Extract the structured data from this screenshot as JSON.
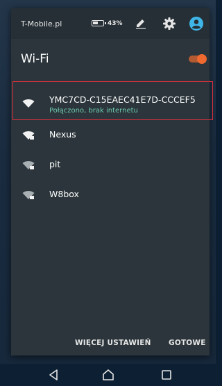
{
  "status_bar": {
    "carrier": "T-Mobile.pl",
    "battery_percent": "43%",
    "icons": [
      "battery-icon",
      "edit-pen-icon",
      "settings-gear-icon",
      "user-account-icon"
    ]
  },
  "wifi": {
    "title": "Wi-Fi",
    "enabled": true,
    "accent_color": "#f06a30"
  },
  "networks": [
    {
      "ssid": "YMC7CD-C15EAEC41E7D-CCCEF5",
      "status": "Połączono, brak internetu",
      "locked": false,
      "selected": true
    },
    {
      "ssid": "Nexus",
      "status": "",
      "locked": true,
      "selected": false
    },
    {
      "ssid": "pit",
      "status": "",
      "locked": true,
      "selected": false
    },
    {
      "ssid": "W8box",
      "status": "",
      "locked": true,
      "selected": false
    }
  ],
  "footer": {
    "more_settings": "WIĘCEJ USTAWIEŃ",
    "done": "GOTOWE"
  },
  "colors": {
    "status_text": "#6fcbb0",
    "highlight_border": "#d9303c"
  },
  "navigation": {
    "icons": [
      "back-icon",
      "home-icon",
      "recents-icon"
    ]
  }
}
